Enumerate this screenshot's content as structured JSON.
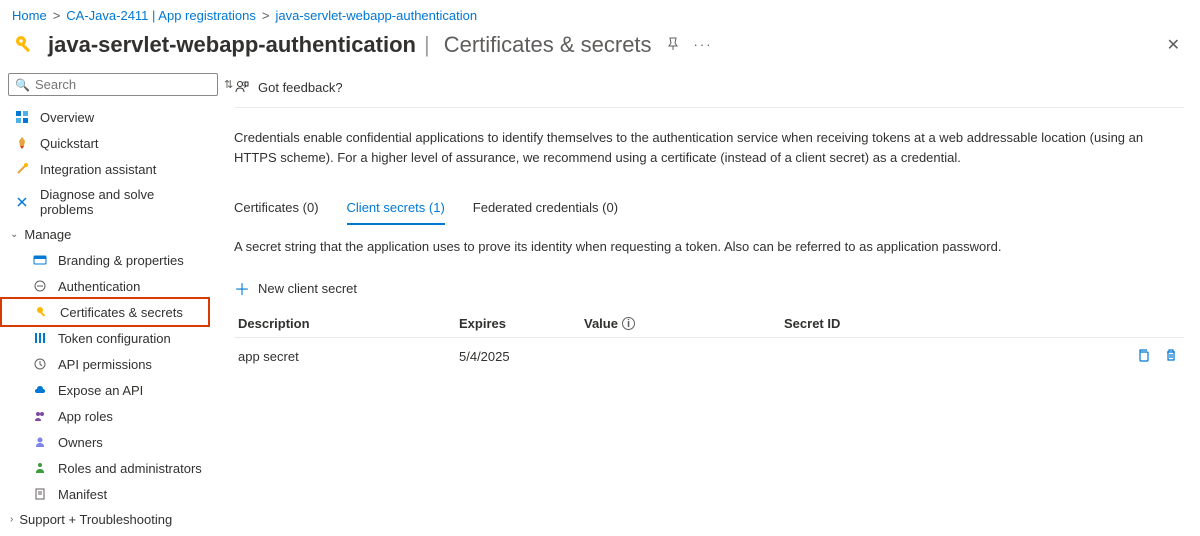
{
  "breadcrumb": {
    "home": "Home",
    "parent": "CA-Java-2411 | App registrations",
    "current": "java-servlet-webapp-authentication"
  },
  "header": {
    "title": "java-servlet-webapp-authentication",
    "subtitle": "Certificates & secrets"
  },
  "search": {
    "placeholder": "Search"
  },
  "nav": {
    "overview": "Overview",
    "quickstart": "Quickstart",
    "integration": "Integration assistant",
    "diagnose": "Diagnose and solve problems",
    "manage": "Manage",
    "branding": "Branding & properties",
    "authn": "Authentication",
    "certs": "Certificates & secrets",
    "token": "Token configuration",
    "api_perm": "API permissions",
    "expose": "Expose an API",
    "app_roles": "App roles",
    "owners": "Owners",
    "roles_admin": "Roles and administrators",
    "manifest": "Manifest",
    "support": "Support + Troubleshooting"
  },
  "toolbar": {
    "feedback": "Got feedback?"
  },
  "description": "Credentials enable confidential applications to identify themselves to the authentication service when receiving tokens at a web addressable location (using an HTTPS scheme). For a higher level of assurance, we recommend using a certificate (instead of a client secret) as a credential.",
  "tabs": {
    "certificates": "Certificates (0)",
    "client_secrets": "Client secrets (1)",
    "federated": "Federated credentials (0)"
  },
  "tab_description": "A secret string that the application uses to prove its identity when requesting a token. Also can be referred to as application password.",
  "new_secret_label": "New client secret",
  "table": {
    "headers": {
      "description": "Description",
      "expires": "Expires",
      "value": "Value",
      "secret_id": "Secret ID"
    },
    "rows": [
      {
        "description": "app secret",
        "expires": "5/4/2025",
        "value": "",
        "secret_id": ""
      }
    ]
  }
}
